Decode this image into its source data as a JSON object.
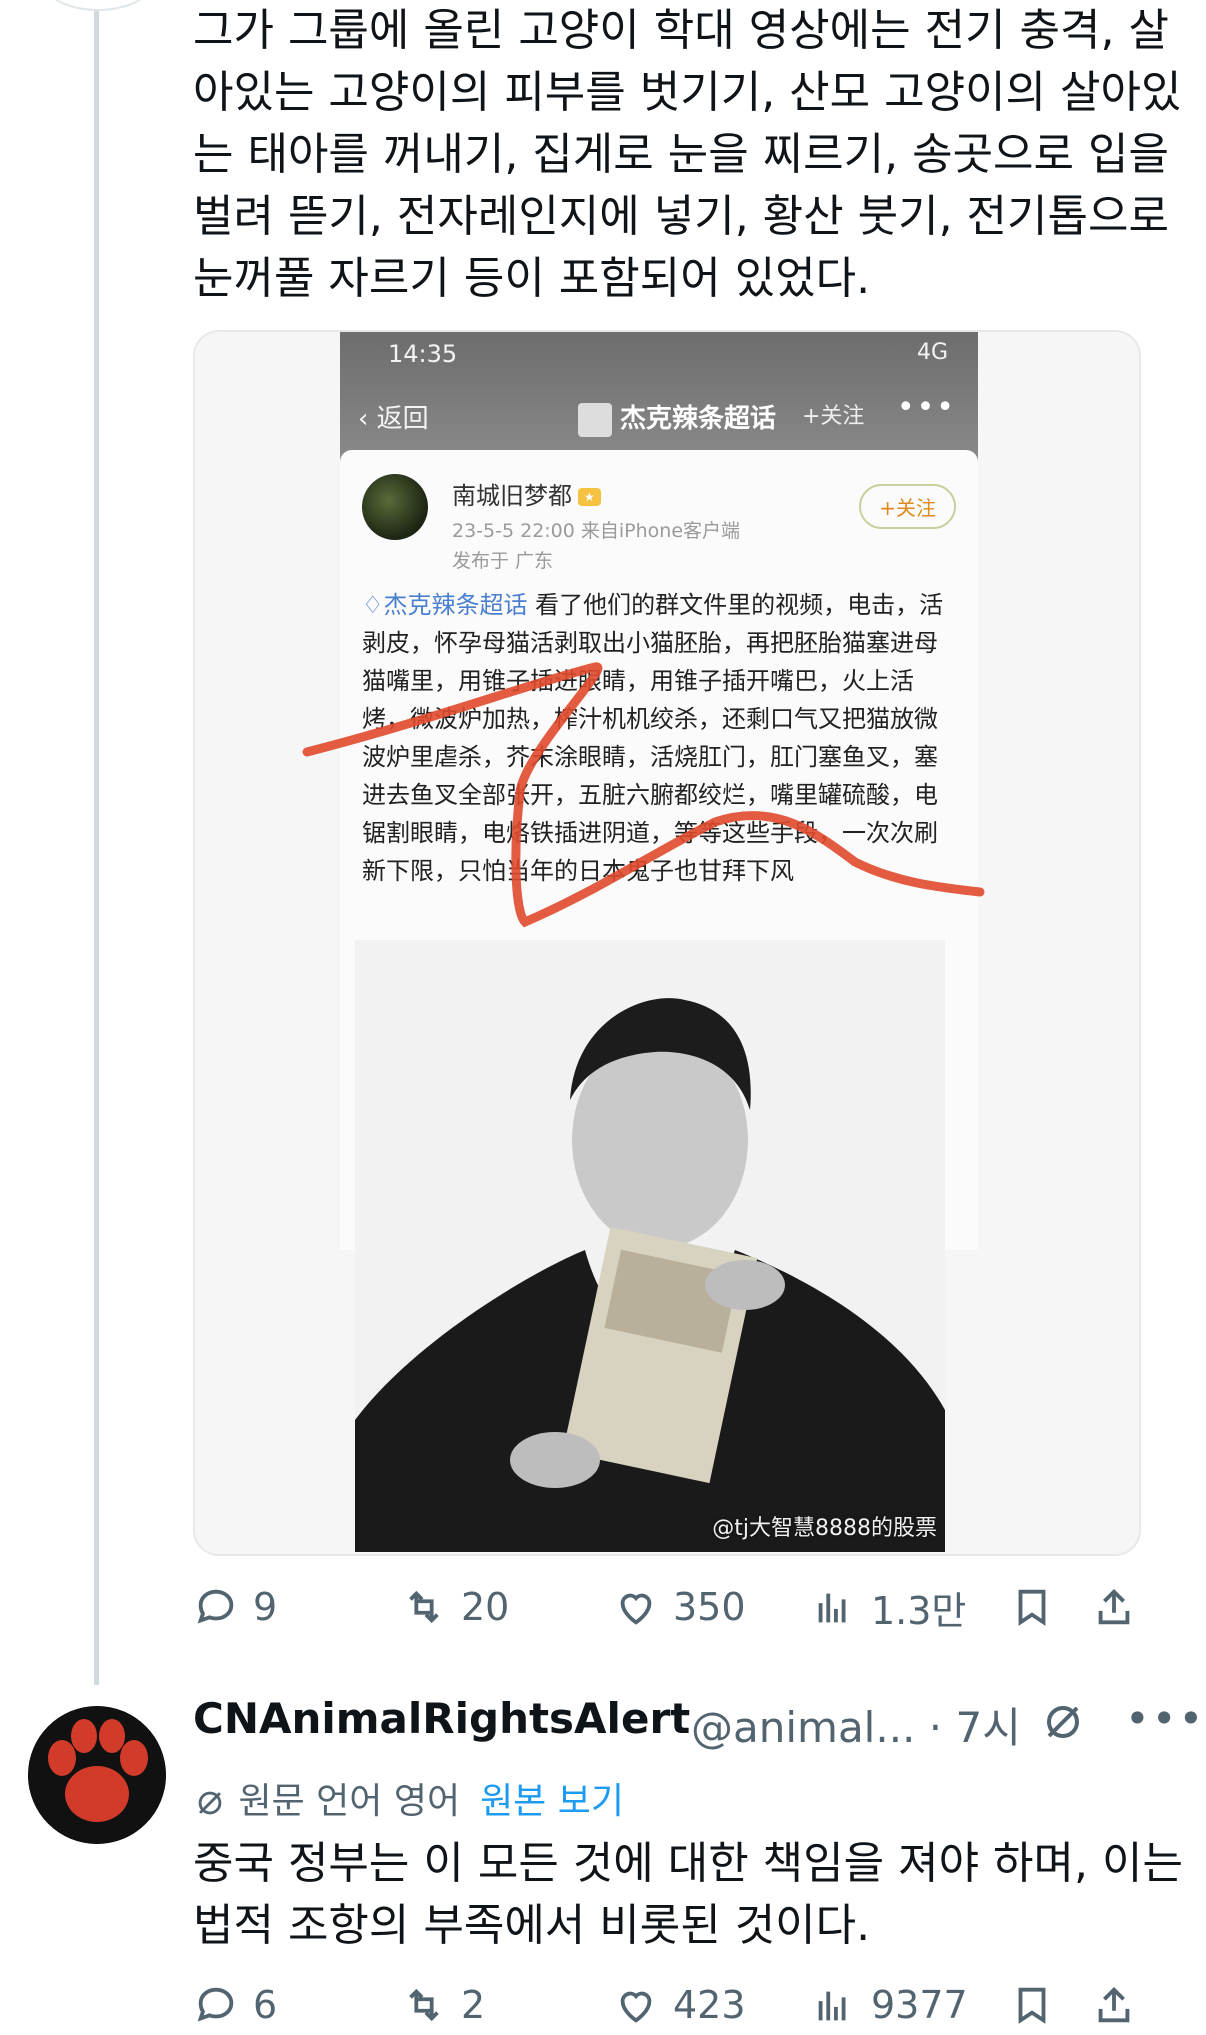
{
  "tweet1": {
    "text": "그가 그룹에 올린 고양이 학대 영상에는 전기 충격, 살아있는 고양이의 피부를 벗기기, 산모 고양이의 살아있는 태아를 꺼내기, 집게로 눈을 찌르기, 송곳으로 입을 벌려 뜯기, 전자레인지에 넣기, 황산 붓기, 전기톱으로 눈꺼풀 자르기 등이 포함되어 있었다.",
    "media": {
      "status_time": "14:35",
      "status_right": "4G",
      "nav_back": "返回",
      "nav_title": "杰克辣条超话",
      "nav_follow": "+关注",
      "nav_more": "•••",
      "post_user": "南城旧梦都",
      "post_meta": "23-5-5 22:00 来自iPhone客户端",
      "post_location": "发布于 广东",
      "post_follow": "+关注",
      "post_topic": "杰克辣条超话",
      "post_body": "看了他们的群文件里的视频，电击，活剥皮，怀孕母猫活剥取出小猫胚胎，再把胚胎猫塞进母猫嘴里，用锥子插进眼睛，用锥子插开嘴巴，火上活烤，微波炉加热，榨汁机机绞杀，还剩口气又把猫放微波炉里虐杀，芥末涂眼睛，活烧肛门，肛门塞鱼叉，塞进去鱼叉全部张开，五脏六腑都绞烂，嘴里罐硫酸，电锯割眼睛，电烙铁插进阴道，等等这些手段，一次次刷新下限，只怕当年的日本鬼子也甘拜下风",
      "watermark": "@tj大智慧8888的股票"
    },
    "actions": {
      "replies": "9",
      "retweets": "20",
      "likes": "350",
      "views": "1.3만"
    }
  },
  "reply": {
    "name": "CNAnimalRightsAlert",
    "handle": "@animal...",
    "time": "· 7시",
    "translated_label": "원문 언어 영어",
    "show_original": "원본 보기",
    "text": "중국 정부는 이 모든 것에 대한 책임을 져야 하며, 이는 법적 조항의 부족에서 비롯된 것이다.",
    "actions": {
      "replies": "6",
      "retweets": "2",
      "likes": "423",
      "views": "9377"
    }
  }
}
